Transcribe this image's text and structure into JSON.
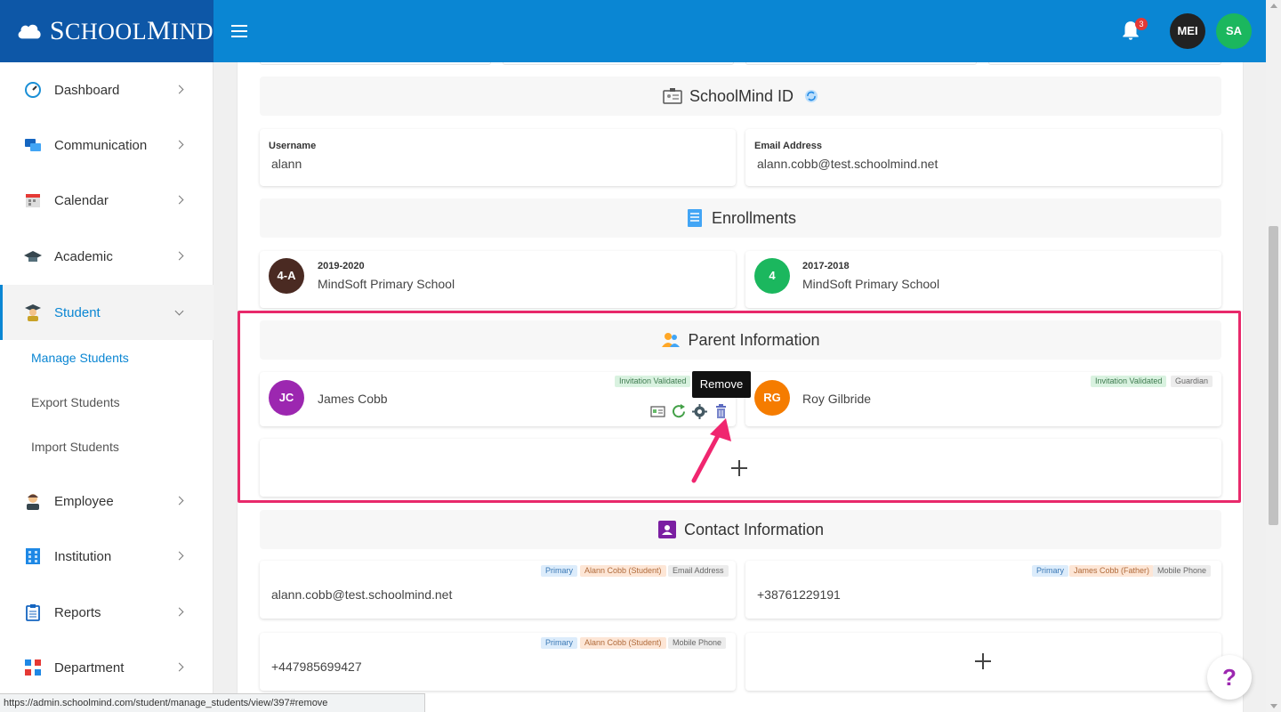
{
  "brand": {
    "name_prefix": "S",
    "name_part1": "CHOOL",
    "name_mid": "M",
    "name_part2": "IND"
  },
  "header": {
    "notification_count": "3",
    "avatars": [
      "MEI",
      "SA"
    ]
  },
  "sidebar": {
    "items": [
      {
        "label": "Dashboard"
      },
      {
        "label": "Communication"
      },
      {
        "label": "Calendar"
      },
      {
        "label": "Academic"
      },
      {
        "label": "Student"
      },
      {
        "label": "Employee"
      },
      {
        "label": "Institution"
      },
      {
        "label": "Reports"
      },
      {
        "label": "Department"
      }
    ],
    "student_subitems": [
      "Manage Students",
      "Export Students",
      "Import Students"
    ]
  },
  "schoolmind_id": {
    "title": "SchoolMind ID",
    "username_label": "Username",
    "username": "alann",
    "email_label": "Email Address",
    "email": "alann.cobb@test.schoolmind.net"
  },
  "enrollments": {
    "title": "Enrollments",
    "items": [
      {
        "badge": "4-A",
        "year": "2019-2020",
        "school": "MindSoft Primary School",
        "color": "#4a2a22"
      },
      {
        "badge": "4",
        "year": "2017-2018",
        "school": "MindSoft Primary School",
        "color": "#1bb75e"
      }
    ]
  },
  "parents": {
    "title": "Parent Information",
    "items": [
      {
        "initials": "JC",
        "name": "James Cobb",
        "color": "#9c27b0",
        "tags": [
          "Invitation Validated"
        ]
      },
      {
        "initials": "RG",
        "name": "Roy Gilbride",
        "color": "#f57c00",
        "tags": [
          "Invitation Validated",
          "Guardian"
        ]
      }
    ],
    "tooltip": "Remove"
  },
  "contacts": {
    "title": "Contact Information",
    "items": [
      {
        "value": "alann.cobb@test.schoolmind.net",
        "tags": [
          "Primary",
          "Alann Cobb (Student)",
          "Email Address"
        ]
      },
      {
        "value": "+38761229191",
        "tags": [
          "Primary",
          "James Cobb (Father)",
          "Mobile Phone"
        ]
      },
      {
        "value": "+447985699427",
        "tags": [
          "Primary",
          "Alann Cobb (Student)",
          "Mobile Phone"
        ]
      }
    ]
  },
  "help_label": "?",
  "status_url": "https://admin.schoolmind.com/student/manage_students/view/397#remove",
  "colors": {
    "brand_dark": "#0d57a7",
    "brand": "#0a86d3",
    "highlight": "#e8296b"
  }
}
